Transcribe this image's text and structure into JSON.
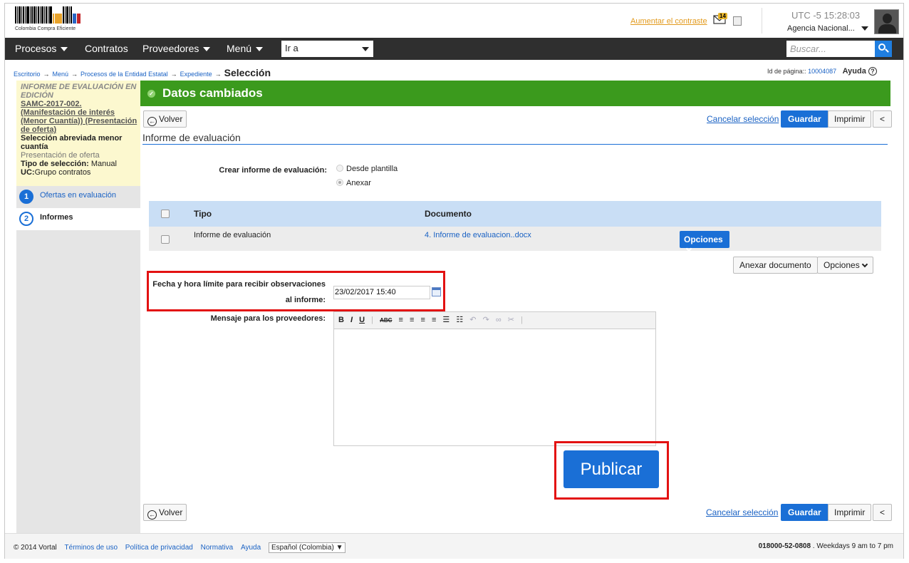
{
  "header": {
    "logo_text": "Colombia Compra Eficiente",
    "contrast_link": "Aumentar el contraste",
    "mail_count": "14",
    "utc_label": "UTC -5",
    "time": "15:28:03",
    "agency": "Agencia Nacional..."
  },
  "nav": {
    "items": [
      "Procesos",
      "Contratos",
      "Proveedores",
      "Menú"
    ],
    "goto_value": "Ir a",
    "search_placeholder": "Buscar..."
  },
  "breadcrumb": {
    "items": [
      "Escritorio",
      "Menú",
      "Procesos de la Entidad Estatal",
      "Expediente"
    ],
    "current": "Selección",
    "page_id_label": "Id de página::",
    "page_id": "10004087",
    "help": "Ayuda"
  },
  "sidebar": {
    "title": "INFORME DE EVALUACIÓN EN EDICIÓN",
    "process_link": "SAMC-2017-002. (Manifestación de interés (Menor Cuantía)) (Presentación de oferta)",
    "process_type": "Selección abreviada menor cuantía",
    "phase": "Presentación de oferta",
    "selection_type_label": "Tipo de selección:",
    "selection_type": "Manual",
    "uc_label": "UC:",
    "uc_value": "Grupo contratos",
    "steps": [
      {
        "num": "1",
        "label": "Ofertas en evaluación"
      },
      {
        "num": "2",
        "label": "Informes"
      }
    ]
  },
  "banner": {
    "message": "Datos cambiados"
  },
  "actions": {
    "back": "Volver",
    "cancel": "Cancelar selección",
    "save": "Guardar",
    "print": "Imprimir",
    "collapse": "<"
  },
  "section": {
    "title": "Informe de evaluación",
    "create_label": "Crear informe de evaluación:",
    "option_template": "Desde plantilla",
    "option_attach": "Anexar"
  },
  "table": {
    "headers": [
      "Tipo",
      "Documento"
    ],
    "rows": [
      {
        "tipo": "Informe de evaluación",
        "documento": "4. Informe de evaluacion..docx",
        "options": "Opciones"
      }
    ]
  },
  "table_actions": {
    "attach": "Anexar documento",
    "options": "Opciones"
  },
  "form": {
    "deadline_label_1": "Fecha y hora límite para recibir observaciones",
    "deadline_label_2": "al informe:",
    "deadline_value": "23/02/2017 15:40",
    "message_label": "Mensaje para los proveedores:"
  },
  "publish": "Publicar",
  "footer": {
    "copyright": "© 2014 Vortal",
    "links": [
      "Términos de uso",
      "Política de privacidad",
      "Normativa",
      "Ayuda"
    ],
    "language": "Español (Colombia)",
    "phone": "018000-52-0808",
    "hours": ". Weekdays 9 am to 7 pm"
  },
  "colors": {
    "accent": "#1a6fd6",
    "success": "#3b9a1d",
    "highlight": "#e31212"
  }
}
